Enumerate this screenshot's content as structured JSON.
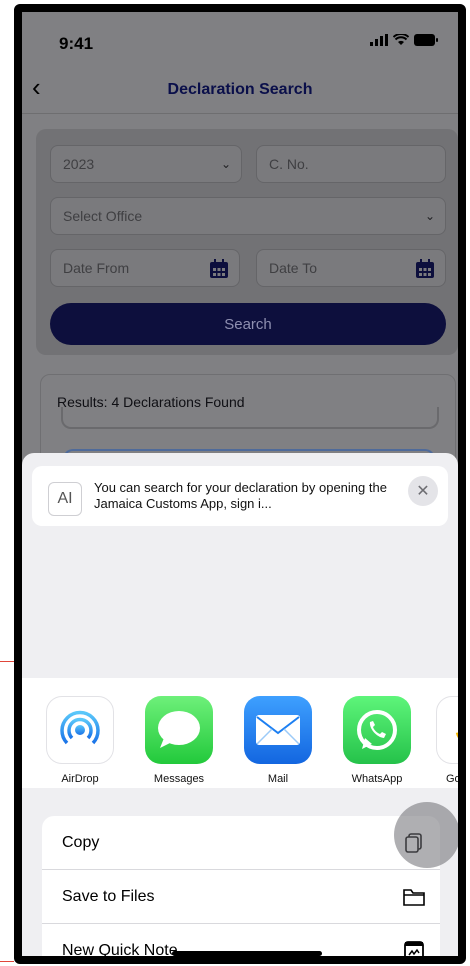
{
  "status": {
    "time": "9:41"
  },
  "nav": {
    "title": "Declaration Search"
  },
  "form": {
    "year": "2023",
    "cno_placeholder": "C. No.",
    "office_placeholder": "Select Office",
    "date_from_placeholder": "Date From",
    "date_to_placeholder": "Date To",
    "search_label": "Search"
  },
  "results": {
    "label": "Results: 4 Declarations Found"
  },
  "share": {
    "preview_glyph": "AI",
    "preview_text": "You can search for your declaration by opening the Jamaica Customs App, sign i...",
    "apps": [
      {
        "label": "AirDrop",
        "icon": "airdrop-icon"
      },
      {
        "label": "Messages",
        "icon": "messages-icon"
      },
      {
        "label": "Mail",
        "icon": "mail-icon"
      },
      {
        "label": "WhatsApp",
        "icon": "whatsapp-icon"
      },
      {
        "label": "Goo",
        "icon": "google-icon"
      }
    ],
    "actions": [
      {
        "label": "Copy",
        "icon": "copy-icon"
      },
      {
        "label": "Save to Files",
        "icon": "folder-icon"
      },
      {
        "label": "New Quick Note",
        "icon": "quick-note-icon"
      }
    ]
  },
  "colors": {
    "accent": "#1e2060",
    "sheet_bg": "#efeff2"
  }
}
